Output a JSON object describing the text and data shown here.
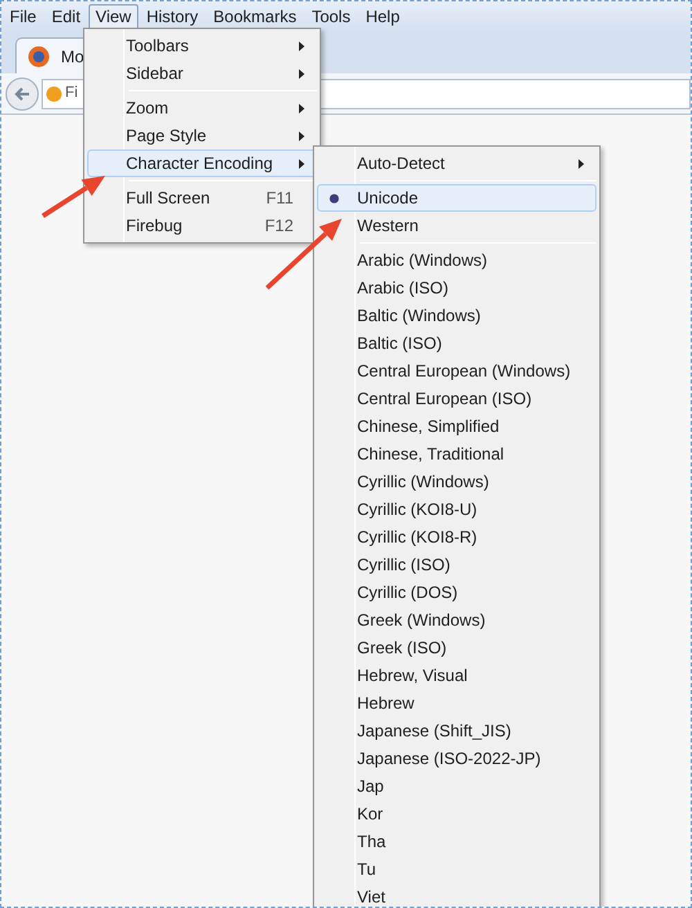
{
  "menubar": [
    {
      "label": "File",
      "selected": false
    },
    {
      "label": "Edit",
      "selected": false
    },
    {
      "label": "View",
      "selected": true
    },
    {
      "label": "History",
      "selected": false
    },
    {
      "label": "Bookmarks",
      "selected": false
    },
    {
      "label": "Tools",
      "selected": false
    },
    {
      "label": "Help",
      "selected": false
    }
  ],
  "tab": {
    "title": "Mo"
  },
  "address_bar": {
    "value": "Fi"
  },
  "view_menu": {
    "items": [
      {
        "kind": "item",
        "label": "Toolbars",
        "submenu": true,
        "selected": false
      },
      {
        "kind": "item",
        "label": "Sidebar",
        "submenu": true,
        "selected": false
      },
      {
        "kind": "separator"
      },
      {
        "kind": "item",
        "label": "Zoom",
        "submenu": true,
        "selected": false
      },
      {
        "kind": "item",
        "label": "Page Style",
        "submenu": true,
        "selected": false
      },
      {
        "kind": "item",
        "label": "Character Encoding",
        "submenu": true,
        "selected": true
      },
      {
        "kind": "separator"
      },
      {
        "kind": "item",
        "label": "Full Screen",
        "shortcut": "F11",
        "submenu": false,
        "selected": false
      },
      {
        "kind": "item",
        "label": "Firebug",
        "shortcut": "F12",
        "submenu": false,
        "selected": false
      }
    ]
  },
  "encoding_menu": {
    "items": [
      {
        "kind": "item",
        "label": "Auto-Detect",
        "submenu": true,
        "checked": false,
        "selected": false
      },
      {
        "kind": "separator"
      },
      {
        "kind": "item",
        "label": "Unicode",
        "submenu": false,
        "checked": true,
        "selected": true
      },
      {
        "kind": "item",
        "label": "Western",
        "submenu": false,
        "checked": false,
        "selected": false
      },
      {
        "kind": "separator"
      },
      {
        "kind": "item",
        "label": "Arabic (Windows)",
        "submenu": false,
        "checked": false,
        "selected": false
      },
      {
        "kind": "item",
        "label": "Arabic (ISO)",
        "submenu": false,
        "checked": false,
        "selected": false
      },
      {
        "kind": "item",
        "label": "Baltic (Windows)",
        "submenu": false,
        "checked": false,
        "selected": false
      },
      {
        "kind": "item",
        "label": "Baltic (ISO)",
        "submenu": false,
        "checked": false,
        "selected": false
      },
      {
        "kind": "item",
        "label": "Central European (Windows)",
        "submenu": false,
        "checked": false,
        "selected": false
      },
      {
        "kind": "item",
        "label": "Central European (ISO)",
        "submenu": false,
        "checked": false,
        "selected": false
      },
      {
        "kind": "item",
        "label": "Chinese, Simplified",
        "submenu": false,
        "checked": false,
        "selected": false
      },
      {
        "kind": "item",
        "label": "Chinese, Traditional",
        "submenu": false,
        "checked": false,
        "selected": false
      },
      {
        "kind": "item",
        "label": "Cyrillic (Windows)",
        "submenu": false,
        "checked": false,
        "selected": false
      },
      {
        "kind": "item",
        "label": "Cyrillic (KOI8-U)",
        "submenu": false,
        "checked": false,
        "selected": false
      },
      {
        "kind": "item",
        "label": "Cyrillic (KOI8-R)",
        "submenu": false,
        "checked": false,
        "selected": false
      },
      {
        "kind": "item",
        "label": "Cyrillic (ISO)",
        "submenu": false,
        "checked": false,
        "selected": false
      },
      {
        "kind": "item",
        "label": "Cyrillic (DOS)",
        "submenu": false,
        "checked": false,
        "selected": false
      },
      {
        "kind": "item",
        "label": "Greek (Windows)",
        "submenu": false,
        "checked": false,
        "selected": false
      },
      {
        "kind": "item",
        "label": "Greek (ISO)",
        "submenu": false,
        "checked": false,
        "selected": false
      },
      {
        "kind": "item",
        "label": "Hebrew, Visual",
        "submenu": false,
        "checked": false,
        "selected": false
      },
      {
        "kind": "item",
        "label": "Hebrew",
        "submenu": false,
        "checked": false,
        "selected": false
      },
      {
        "kind": "item",
        "label": "Japanese (Shift_JIS)",
        "submenu": false,
        "checked": false,
        "selected": false
      },
      {
        "kind": "item",
        "label": "Japanese (ISO-2022-JP)",
        "submenu": false,
        "checked": false,
        "selected": false
      },
      {
        "kind": "item",
        "label": "Jap",
        "submenu": false,
        "checked": false,
        "selected": false
      },
      {
        "kind": "item",
        "label": "Kor",
        "submenu": false,
        "checked": false,
        "selected": false
      },
      {
        "kind": "item",
        "label": "Tha",
        "submenu": false,
        "checked": false,
        "selected": false
      },
      {
        "kind": "item",
        "label": "Tu",
        "submenu": false,
        "checked": false,
        "selected": false
      },
      {
        "kind": "item",
        "label": "Viet",
        "submenu": false,
        "checked": false,
        "selected": false
      }
    ]
  }
}
